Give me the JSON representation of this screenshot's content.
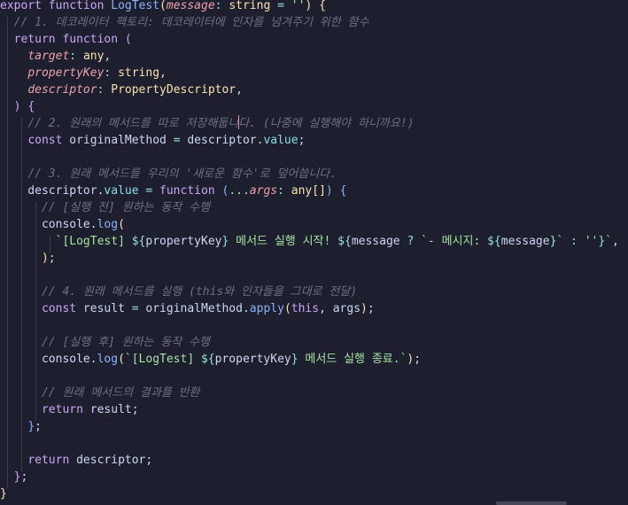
{
  "editor": {
    "colors": {
      "background": "#1e1f2e",
      "keyword": "#cba6f7",
      "function": "#89b4fa",
      "param": "#eba0ac",
      "type": "#f9e2af",
      "string": "#a6e3a1",
      "comment": "#6c7086",
      "property": "#89dceb",
      "text": "#cdd6f4",
      "operator": "#94e2d5",
      "bracket1": "#f9e2af",
      "bracket2": "#cba6f7",
      "bracket3": "#89b4fa"
    },
    "lines": [
      [
        [
          "kw",
          "export"
        ],
        [
          "t",
          " "
        ],
        [
          "kw",
          "function"
        ],
        [
          "t",
          " "
        ],
        [
          "fn",
          "LogTest"
        ],
        [
          "b1",
          "("
        ],
        [
          "pi",
          "message"
        ],
        [
          "op",
          ":"
        ],
        [
          "t",
          " "
        ],
        [
          "ty",
          "string"
        ],
        [
          "t",
          " "
        ],
        [
          "op",
          "="
        ],
        [
          "t",
          " "
        ],
        [
          "str",
          "''"
        ],
        [
          "b1",
          ")"
        ],
        [
          "t",
          " "
        ],
        [
          "b1",
          "{"
        ]
      ],
      [
        [
          "t",
          "  "
        ],
        [
          "cm",
          "// 1. 데코레이터 팩토리: 데코레이터에 인자를 넘겨주기 위한 함수"
        ]
      ],
      [
        [
          "t",
          "  "
        ],
        [
          "kw",
          "return"
        ],
        [
          "t",
          " "
        ],
        [
          "kw",
          "function"
        ],
        [
          "t",
          " "
        ],
        [
          "b2",
          "("
        ]
      ],
      [
        [
          "t",
          "    "
        ],
        [
          "pi",
          "target"
        ],
        [
          "op",
          ":"
        ],
        [
          "t",
          " "
        ],
        [
          "ty",
          "any"
        ],
        [
          "t",
          ","
        ]
      ],
      [
        [
          "t",
          "    "
        ],
        [
          "pi",
          "propertyKey"
        ],
        [
          "op",
          ":"
        ],
        [
          "t",
          " "
        ],
        [
          "ty",
          "string"
        ],
        [
          "t",
          ","
        ]
      ],
      [
        [
          "t",
          "    "
        ],
        [
          "pi",
          "descriptor"
        ],
        [
          "op",
          ":"
        ],
        [
          "t",
          " "
        ],
        [
          "ty",
          "PropertyDescriptor"
        ],
        [
          "t",
          ","
        ]
      ],
      [
        [
          "t",
          "  "
        ],
        [
          "b2",
          ")"
        ],
        [
          "t",
          " "
        ],
        [
          "b2",
          "{"
        ]
      ],
      [
        [
          "t",
          "    "
        ],
        [
          "cm",
          "// 2. 원래의 메서드를 따로 저장해둡니"
        ],
        [
          "cursor",
          ""
        ],
        [
          "cm",
          "다. (나중에 실행해야 하니까요!)"
        ]
      ],
      [
        [
          "t",
          "    "
        ],
        [
          "kw",
          "const"
        ],
        [
          "t",
          " originalMethod "
        ],
        [
          "op",
          "="
        ],
        [
          "t",
          " descriptor."
        ],
        [
          "pr",
          "value"
        ],
        [
          "t",
          ";"
        ]
      ],
      [
        [
          "t",
          ""
        ]
      ],
      [
        [
          "t",
          "    "
        ],
        [
          "cm",
          "// 3. 원래 메서드를 우리의 '새로운 함수'로 덮어씁니다."
        ]
      ],
      [
        [
          "t",
          "    descriptor."
        ],
        [
          "pr",
          "value"
        ],
        [
          "t",
          " "
        ],
        [
          "op",
          "="
        ],
        [
          "t",
          " "
        ],
        [
          "kw",
          "function"
        ],
        [
          "t",
          " "
        ],
        [
          "b3",
          "("
        ],
        [
          "op",
          "..."
        ],
        [
          "pi",
          "args"
        ],
        [
          "op",
          ":"
        ],
        [
          "t",
          " "
        ],
        [
          "ty",
          "any"
        ],
        [
          "b1",
          "[]"
        ],
        [
          "b3",
          ")"
        ],
        [
          "t",
          " "
        ],
        [
          "b3",
          "{"
        ]
      ],
      [
        [
          "t",
          "      "
        ],
        [
          "cm",
          "// [실행 전] 원하는 동작 수행"
        ]
      ],
      [
        [
          "t",
          "      console."
        ],
        [
          "fn",
          "log"
        ],
        [
          "b1",
          "("
        ]
      ],
      [
        [
          "t",
          "        "
        ],
        [
          "str",
          "`[LogTest] "
        ],
        [
          "op",
          "${"
        ],
        [
          "t",
          "propertyKey"
        ],
        [
          "op",
          "}"
        ],
        [
          "str",
          " 메서드 실행 시작! "
        ],
        [
          "op",
          "${"
        ],
        [
          "t",
          "message "
        ],
        [
          "op",
          "?"
        ],
        [
          "t",
          " "
        ],
        [
          "str",
          "`- 메시지: "
        ],
        [
          "op",
          "${"
        ],
        [
          "t",
          "message"
        ],
        [
          "op",
          "}"
        ],
        [
          "str",
          "`"
        ],
        [
          "t",
          " "
        ],
        [
          "op",
          ":"
        ],
        [
          "t",
          " "
        ],
        [
          "str",
          "''"
        ],
        [
          "op",
          "}"
        ],
        [
          "str",
          "`"
        ],
        [
          "t",
          ","
        ]
      ],
      [
        [
          "t",
          "      "
        ],
        [
          "b1",
          ")"
        ],
        [
          "t",
          ";"
        ]
      ],
      [
        [
          "t",
          ""
        ]
      ],
      [
        [
          "t",
          "      "
        ],
        [
          "cm",
          "// 4. 원래 메서드를 실행 (this와 인자들을 그대로 전달)"
        ]
      ],
      [
        [
          "t",
          "      "
        ],
        [
          "kw",
          "const"
        ],
        [
          "t",
          " result "
        ],
        [
          "op",
          "="
        ],
        [
          "t",
          " originalMethod."
        ],
        [
          "fn",
          "apply"
        ],
        [
          "b1",
          "("
        ],
        [
          "kw",
          "this"
        ],
        [
          "t",
          ", args"
        ],
        [
          "b1",
          ")"
        ],
        [
          "t",
          ";"
        ]
      ],
      [
        [
          "t",
          ""
        ]
      ],
      [
        [
          "t",
          "      "
        ],
        [
          "cm",
          "// [실행 후] 원하는 동작 수행"
        ]
      ],
      [
        [
          "t",
          "      console."
        ],
        [
          "fn",
          "log"
        ],
        [
          "b1",
          "("
        ],
        [
          "str",
          "`[LogTest] "
        ],
        [
          "op",
          "${"
        ],
        [
          "t",
          "propertyKey"
        ],
        [
          "op",
          "}"
        ],
        [
          "str",
          " 메서드 실행 종료.`"
        ],
        [
          "b1",
          ")"
        ],
        [
          "t",
          ";"
        ]
      ],
      [
        [
          "t",
          ""
        ]
      ],
      [
        [
          "t",
          "      "
        ],
        [
          "cm",
          "// 원래 메서드의 결과를 반환"
        ]
      ],
      [
        [
          "t",
          "      "
        ],
        [
          "kw",
          "return"
        ],
        [
          "t",
          " result;"
        ]
      ],
      [
        [
          "t",
          "    "
        ],
        [
          "b3",
          "}"
        ],
        [
          "t",
          ";"
        ]
      ],
      [
        [
          "t",
          ""
        ]
      ],
      [
        [
          "t",
          "    "
        ],
        [
          "kw",
          "return"
        ],
        [
          "t",
          " descriptor;"
        ]
      ],
      [
        [
          "t",
          "  "
        ],
        [
          "b2",
          "}"
        ],
        [
          "t",
          ";"
        ]
      ],
      [
        [
          "b1",
          "}"
        ]
      ]
    ]
  }
}
